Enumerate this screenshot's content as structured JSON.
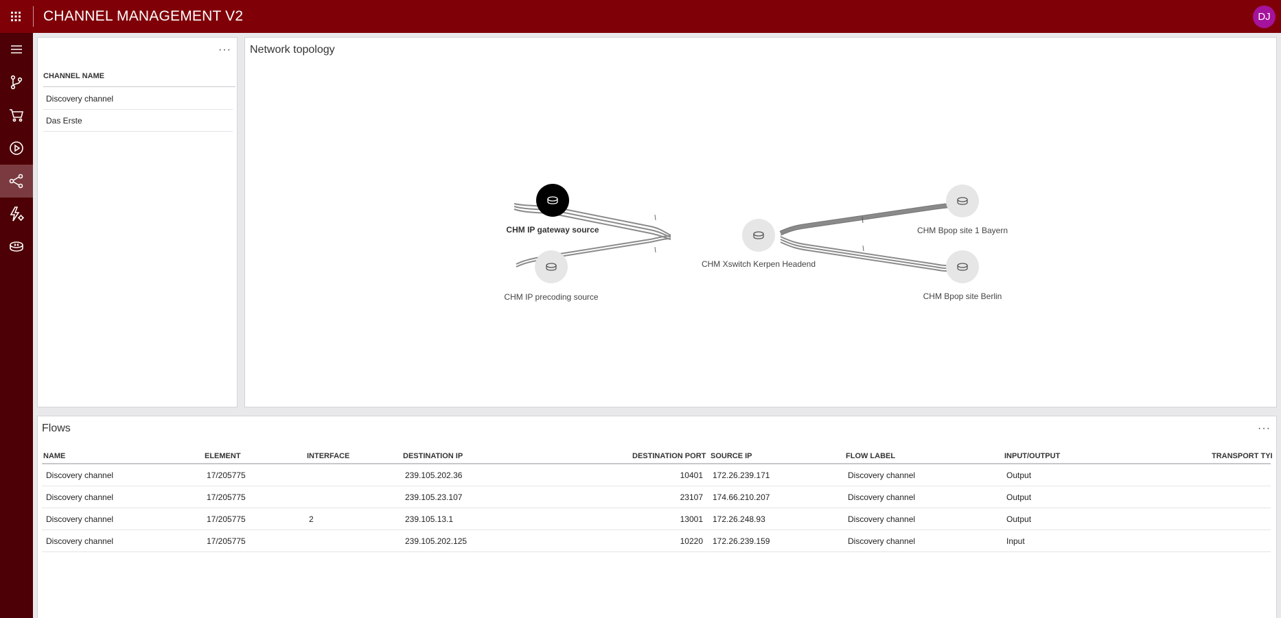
{
  "app": {
    "title": "CHANNEL MANAGEMENT V2",
    "user_initials": "DJ"
  },
  "colors": {
    "topbar": "#800008",
    "sidebar": "#4d0005",
    "avatar": "#a5129c",
    "active_nav": "#7a3a40"
  },
  "sidebar": {
    "items": [
      {
        "icon": "hamburger-icon"
      },
      {
        "icon": "source-branch-icon"
      },
      {
        "icon": "cart-icon"
      },
      {
        "icon": "play-circle-icon"
      },
      {
        "icon": "share-topology-icon",
        "active": true
      },
      {
        "icon": "flash-settings-icon"
      },
      {
        "icon": "router-icon"
      }
    ]
  },
  "channels": {
    "column_header": "CHANNEL NAME",
    "rows": [
      "Discovery channel",
      "Das Erste"
    ]
  },
  "topology": {
    "title": "Network topology",
    "nodes": [
      {
        "label": "CHM IP gateway source",
        "selected": true
      },
      {
        "label": "CHM IP precoding source",
        "selected": false
      },
      {
        "label": "CHM Xswitch Kerpen Headend",
        "selected": false
      },
      {
        "label": "CHM Bpop site 1 Bayern",
        "selected": false
      },
      {
        "label": "CHM Bpop site Berlin",
        "selected": false
      }
    ]
  },
  "flows": {
    "title": "Flows",
    "columns": [
      "NAME",
      "ELEMENT",
      "INTERFACE",
      "DESTINATION IP",
      "DESTINATION PORT",
      "SOURCE IP",
      "FLOW LABEL",
      "INPUT/OUTPUT",
      "TRANSPORT TYI"
    ],
    "rows": [
      {
        "name": "Discovery channel",
        "element": "17/205775",
        "interface": "",
        "destination_ip": "239.105.202.36",
        "destination_port": "10401",
        "source_ip": "172.26.239.171",
        "flow_label": "Discovery channel",
        "io": "Output",
        "transport": ""
      },
      {
        "name": "Discovery channel",
        "element": "17/205775",
        "interface": "",
        "destination_ip": "239.105.23.107",
        "destination_port": "23107",
        "source_ip": "174.66.210.207",
        "flow_label": "Discovery channel",
        "io": "Output",
        "transport": ""
      },
      {
        "name": "Discovery channel",
        "element": "17/205775",
        "interface": "2",
        "destination_ip": "239.105.13.1",
        "destination_port": "13001",
        "source_ip": "172.26.248.93",
        "flow_label": "Discovery channel",
        "io": "Output",
        "transport": ""
      },
      {
        "name": "Discovery channel",
        "element": "17/205775",
        "interface": "",
        "destination_ip": "239.105.202.125",
        "destination_port": "10220",
        "source_ip": "172.26.239.159",
        "flow_label": "Discovery channel",
        "io": "Input",
        "transport": ""
      }
    ]
  }
}
